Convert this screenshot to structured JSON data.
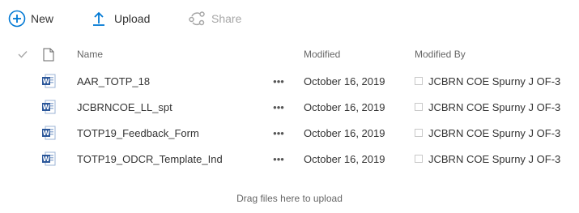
{
  "toolbar": {
    "new_label": "New",
    "upload_label": "Upload",
    "share_label": "Share"
  },
  "columns": {
    "name": "Name",
    "modified": "Modified",
    "modified_by": "Modified By"
  },
  "files": [
    {
      "name": "AAR_TOTP_18",
      "more": "•••",
      "modified": "October 16, 2019",
      "modified_by": "JCBRN COE Spurny J OF-3",
      "icon": "word-doc-icon"
    },
    {
      "name": "JCBRNCOE_LL_spt",
      "more": "•••",
      "modified": "October 16, 2019",
      "modified_by": "JCBRN COE Spurny J OF-3",
      "icon": "word-doc-icon"
    },
    {
      "name": "TOTP19_Feedback_Form",
      "more": "•••",
      "modified": "October 16, 2019",
      "modified_by": "JCBRN COE Spurny J OF-3",
      "icon": "word-doc-icon"
    },
    {
      "name": "TOTP19_ODCR_Template_Ind",
      "more": "•••",
      "modified": "October 16, 2019",
      "modified_by": "JCBRN COE Spurny J OF-3",
      "icon": "word-doc-icon"
    }
  ],
  "dropzone_text": "Drag files here to upload",
  "colors": {
    "accent": "#0078d4",
    "word_blue": "#2b579a",
    "disabled": "#a6a6a6"
  }
}
